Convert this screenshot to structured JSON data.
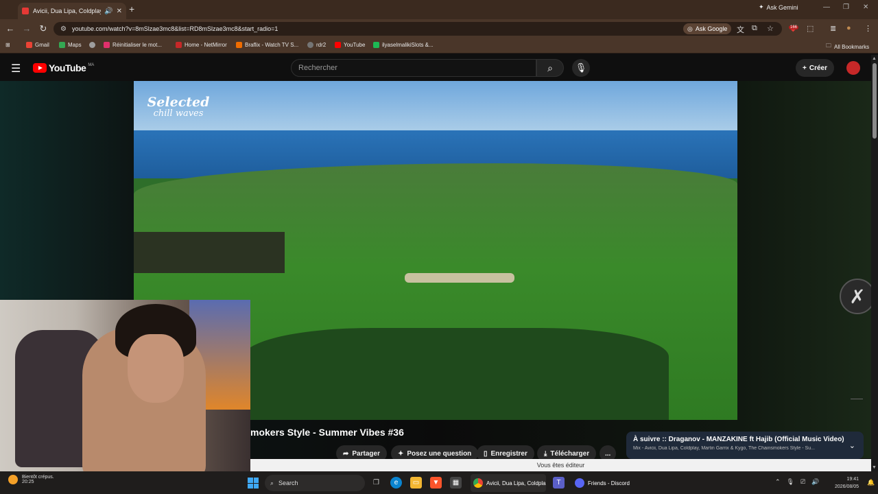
{
  "browser": {
    "tab_title": "Avicii, Dua Lipa, Coldplay, M",
    "new_tab_icon": "plus-icon",
    "ask_gemini": "Ask Gemini",
    "url": "youtube.com/watch?v=8mSlzae3mc8&list=RD8mSlzae3mc8&start_radio=1",
    "ask_google": "Ask Google",
    "extension_badge": "166",
    "bookmarks": [
      {
        "label": "Gmail",
        "color": "#ea4335"
      },
      {
        "label": "Maps",
        "color": "#34a853"
      },
      {
        "label": "",
        "color": "#9e9e9e"
      },
      {
        "label": "Réinitialiser le mot...",
        "color": "#e1306c"
      },
      {
        "label": "Home - NetMirror",
        "color": "#c62828"
      },
      {
        "label": "Braflix - Watch TV S...",
        "color": "#ef6c00"
      },
      {
        "label": "rdr2",
        "color": "#757575"
      },
      {
        "label": "YouTube",
        "color": "#ff0000"
      },
      {
        "label": "ilyaselmalikiSlots &...",
        "color": "#1db954"
      }
    ],
    "all_bookmarks": "All Bookmarks"
  },
  "youtube": {
    "logo_text": "YouTube",
    "region": "MA",
    "search_placeholder": "Rechercher",
    "create_label": "Créer",
    "watermark_line1": "Selected",
    "watermark_line2": "chill waves",
    "video_title": "mokers Style - Summer Vibes #36",
    "actions": {
      "share": "Partager",
      "ask": "Posez une question",
      "save": "Enregistrer",
      "download": "Télécharger",
      "more": "..."
    },
    "up_next_title": "À suivre :: Draganov - MANZAKINE ft Hajib (Official Music Video)",
    "up_next_subtitle": "Mix - Avicii, Dua Lipa, Coldplay, Martin Garrix & Kygo, The Chainsmokers Style - Su...",
    "editor_bar": "Vous êtes éditeur"
  },
  "taskbar": {
    "weather_line1": "Bientôt crépus.",
    "weather_line2": "20:25",
    "search_label": "Search",
    "chrome_label": "Avicii, Dua Lipa, Coldpla",
    "discord_label": "Friends - Discord",
    "time": "19:41",
    "date": "2026/08/05"
  },
  "colors": {
    "accent_red": "#ff0000",
    "chrome_brown": "#4a3629"
  }
}
